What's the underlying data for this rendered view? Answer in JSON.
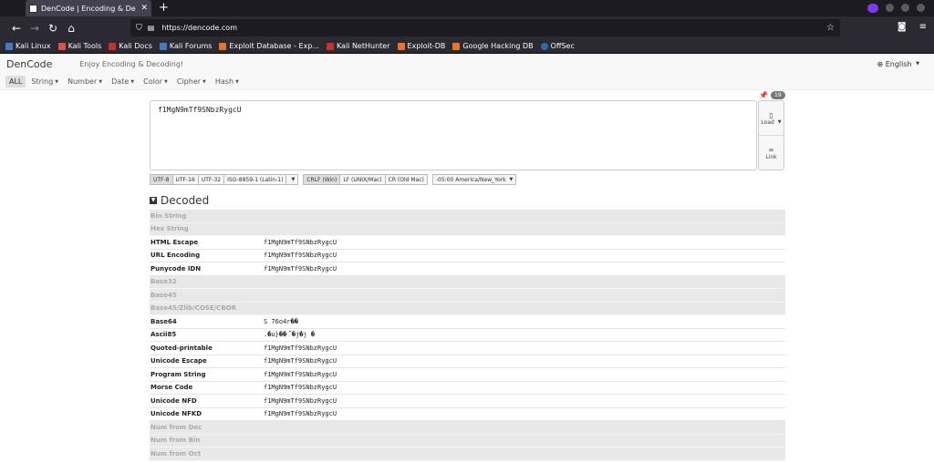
{
  "browser": {
    "tab_title": "DenCode | Encoding & De",
    "url": "https://dencode.com",
    "bookmarks": [
      "Kali Linux",
      "Kali Tools",
      "Kali Docs",
      "Kali Forums",
      "Exploit Database - Exp...",
      "Kali NetHunter",
      "Exploit-DB",
      "Google Hacking DB",
      "OffSec"
    ]
  },
  "site": {
    "brand": "DenCode",
    "tagline": "Enjoy Encoding & Decoding!",
    "language": "English",
    "menus": [
      "ALL",
      "String",
      "Number",
      "Date",
      "Color",
      "Cipher",
      "Hash"
    ]
  },
  "editor": {
    "value": "f1MgN9mTf9SNbzRygcU",
    "count": "19",
    "load_label": "Load",
    "link_label": "Link"
  },
  "options": {
    "charsets": [
      "UTF-8",
      "UTF-16",
      "UTF-32",
      "ISO-8859-1 (Latin-1)"
    ],
    "newlines": [
      "CRLF (Win)",
      "LF (UNIX/Mac)",
      "CR (Old Mac)"
    ],
    "timezone": "-05:00 America/New_York"
  },
  "decoded": {
    "title": "Decoded",
    "rows": [
      {
        "label": "Bin String",
        "value": "",
        "disabled": true
      },
      {
        "label": "Hex String",
        "value": "",
        "disabled": true
      },
      {
        "label": "HTML Escape",
        "value": "f1MgN9mTf9SNbzRygcU",
        "disabled": false
      },
      {
        "label": "URL Encoding",
        "value": "f1MgN9mTf9SNbzRygcU",
        "disabled": false
      },
      {
        "label": "Punycode IDN",
        "value": "f1MgN9mTf9SNbzRygcU",
        "disabled": false
      },
      {
        "label": "Base32",
        "value": "",
        "disabled": true
      },
      {
        "label": "Base45",
        "value": "",
        "disabled": true
      },
      {
        "label": "Base45/Zlib/COSE/CBOR",
        "value": "",
        "disabled": true
      },
      {
        "label": "Base64",
        "value": "S 76o4r��",
        "disabled": false
      },
      {
        "label": "Ascii85",
        "value": ".�u}��ଁ�j�j �",
        "disabled": false
      },
      {
        "label": "Quoted-printable",
        "value": "f1MgN9mTf9SNbzRygcU",
        "disabled": false
      },
      {
        "label": "Unicode Escape",
        "value": "f1MgN9mTf9SNbzRygcU",
        "disabled": false
      },
      {
        "label": "Program String",
        "value": "f1MgN9mTf9SNbzRygcU",
        "disabled": false
      },
      {
        "label": "Morse Code",
        "value": "f1MgN9mTf9SNbzRygcU",
        "disabled": false
      },
      {
        "label": "Unicode NFD",
        "value": "f1MgN9mTf9SNbzRygcU",
        "disabled": false
      },
      {
        "label": "Unicode NFKD",
        "value": "f1MgN9mTf9SNbzRygcU",
        "disabled": false
      },
      {
        "label": "Num from Dec",
        "value": "",
        "disabled": true
      },
      {
        "label": "Num from Bin",
        "value": "",
        "disabled": true
      },
      {
        "label": "Num from Oct",
        "value": "",
        "disabled": true
      }
    ]
  }
}
